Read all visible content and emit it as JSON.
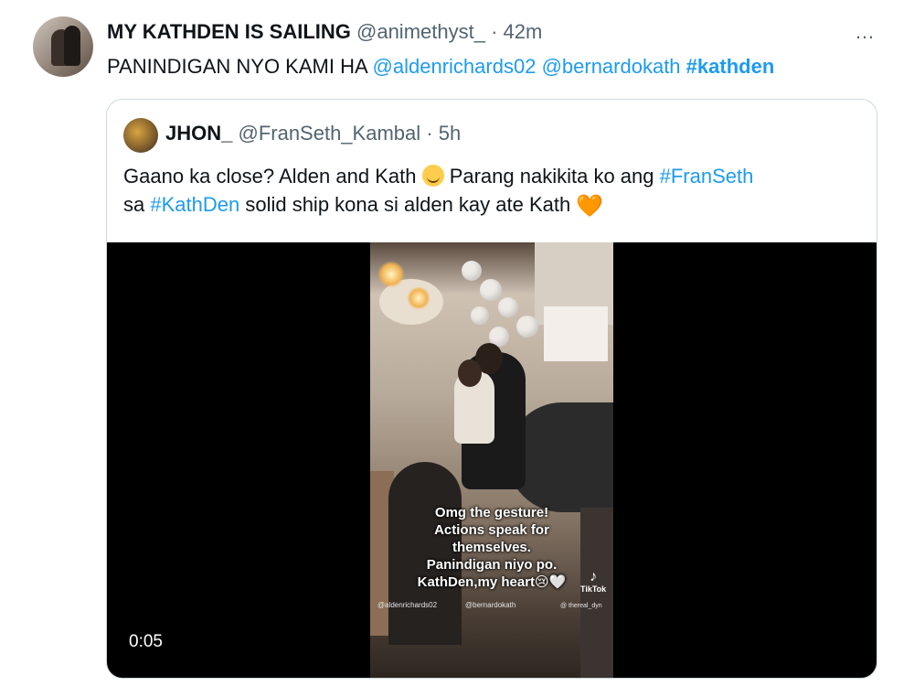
{
  "author": {
    "display_name": "MY KATHDEN IS SAILING",
    "handle": "@animethyst_",
    "separator": "·",
    "time": "42m"
  },
  "more_icon": "…",
  "tweet": {
    "text": "PANINDIGAN NYO KAMI HA",
    "mention1": "@aldenrichards02",
    "mention2": "@bernardokath",
    "hashtag": "#kathden"
  },
  "quote": {
    "display_name": "JHON_",
    "handle": "@FranSeth_Kambal",
    "separator": "·",
    "time": "5h",
    "line1_part1": "Gaano ka close? Alden and Kath ",
    "line1_part2": " Parang nakikita ko ang ",
    "line1_hashtag": "#FranSeth",
    "line2_part1": "sa  ",
    "line2_hashtag": "#KathDen",
    "line2_part2": "  solid ship kona si alden kay ate Kath ",
    "heart": "🧡"
  },
  "video": {
    "caption_lines": [
      "Omg the gesture!",
      "Actions speak for",
      "themselves.",
      "Panindigan niyo po.",
      "KathDen,my heart😢🤍"
    ],
    "watermark_left": "@aldenrichards02",
    "watermark_mid": "@bernardokath",
    "tiktok_label": "TikTok",
    "tiktok_user": "@ thereal_dyn",
    "timestamp": "0:05"
  }
}
